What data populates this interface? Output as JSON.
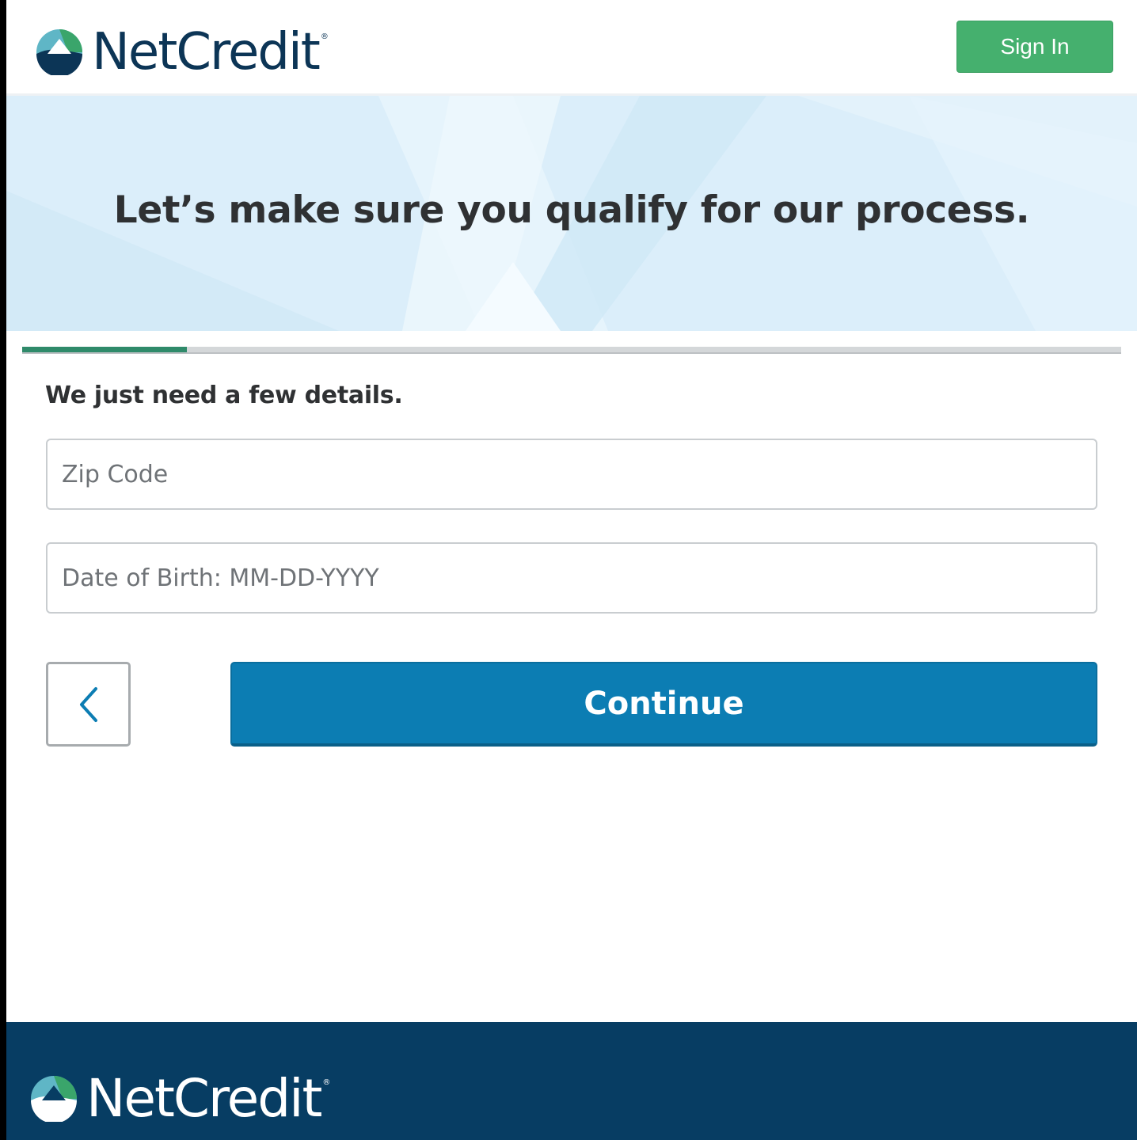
{
  "header": {
    "brand": "NetCredit",
    "trademark": "®",
    "signin_label": "Sign In"
  },
  "hero": {
    "title": "Let’s make sure you qualify for our process."
  },
  "progress": {
    "fraction": 0.15
  },
  "form": {
    "heading": "We just need a few details.",
    "zip_placeholder": "Zip Code",
    "dob_placeholder": "Date of Birth: MM-DD-YYYY",
    "continue_label": "Continue",
    "back_icon": "chevron-left-icon"
  },
  "footer": {
    "brand": "NetCredit",
    "trademark": "®"
  },
  "colors": {
    "brand_navy": "#0c3556",
    "signin_green": "#45b06e",
    "primary_blue": "#0c7db3",
    "progress_green": "#2f8a6a",
    "footer_bg": "#073d63",
    "hero_bg": "#dbeefa"
  }
}
